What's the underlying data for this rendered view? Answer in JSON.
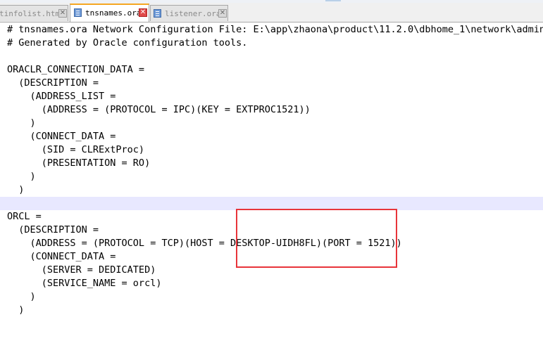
{
  "tabs": [
    {
      "label": "tinfolist.html",
      "active": false,
      "close": "✕"
    },
    {
      "label": "tnsnames.ora",
      "active": true,
      "close": "✕"
    },
    {
      "label": "listener.ora",
      "active": false,
      "close": "✕"
    }
  ],
  "code_lines": [
    "# tnsnames.ora Network Configuration File: E:\\app\\zhaona\\product\\11.2.0\\dbhome_1\\network\\admin\\tnsnames.ora",
    "# Generated by Oracle configuration tools.",
    "",
    "ORACLR_CONNECTION_DATA =",
    "  (DESCRIPTION =",
    "    (ADDRESS_LIST =",
    "      (ADDRESS = (PROTOCOL = IPC)(KEY = EXTPROC1521))",
    "    )",
    "    (CONNECT_DATA =",
    "      (SID = CLRExtProc)",
    "      (PRESENTATION = RO)",
    "    )",
    "  )",
    "",
    "ORCL =",
    "  (DESCRIPTION =",
    "    (ADDRESS = (PROTOCOL = TCP)(HOST = DESKTOP-UIDH8FL)(PORT = 1521))",
    "    (CONNECT_DATA =",
    "      (SERVER = DEDICATED)",
    "      (SERVICE_NAME = orcl)",
    "    )",
    "  )"
  ],
  "current_line_index": 13,
  "colors": {
    "active_tab_accent": "#f5a623",
    "current_line": "#e8e8ff",
    "annotation_box": "#e8343a"
  }
}
